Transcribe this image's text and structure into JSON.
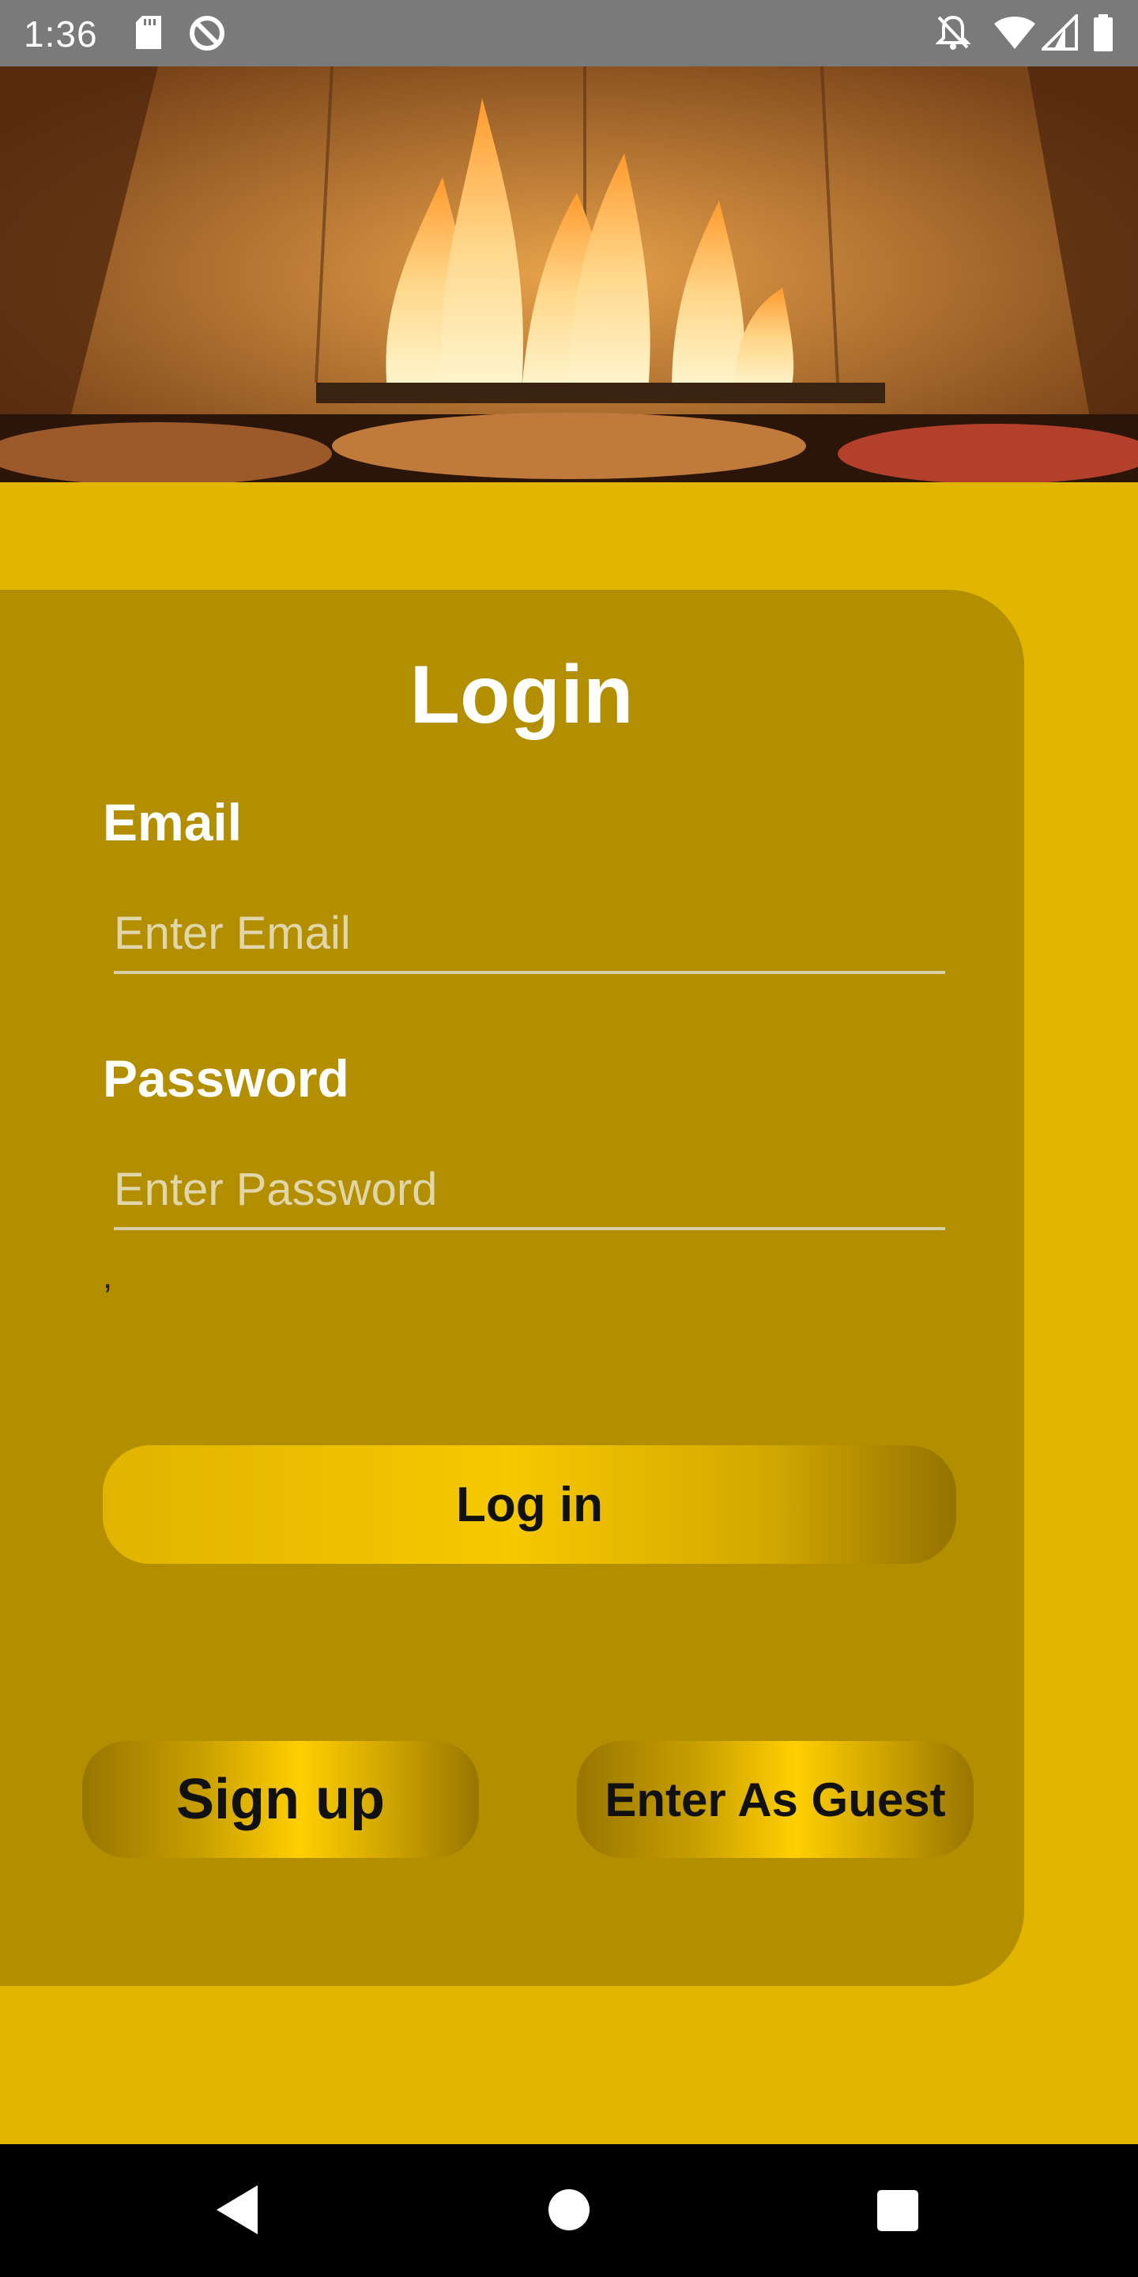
{
  "status_bar": {
    "time": "1:36",
    "icons": [
      "sd-card-icon",
      "do-not-disturb-icon",
      "bell-off-icon",
      "wifi-icon",
      "signal-icon",
      "battery-icon"
    ]
  },
  "hero": {
    "image": "pizza-oven-fire-image"
  },
  "login": {
    "title": "Login",
    "email_label": "Email",
    "email_placeholder": "Enter Email",
    "email_value": "",
    "password_label": "Password",
    "password_placeholder": "Enter Password",
    "password_value": "",
    "error_text": ",",
    "login_button": "Log in",
    "signup_button": "Sign up",
    "guest_button": "Enter As Guest"
  },
  "nav_bar": {
    "icons": [
      "back-icon",
      "home-icon",
      "recents-icon"
    ]
  },
  "colors": {
    "background": "#e2b600",
    "card": "#b38f00",
    "status_bar": "#7a7a7a",
    "nav_bar": "#000000"
  }
}
